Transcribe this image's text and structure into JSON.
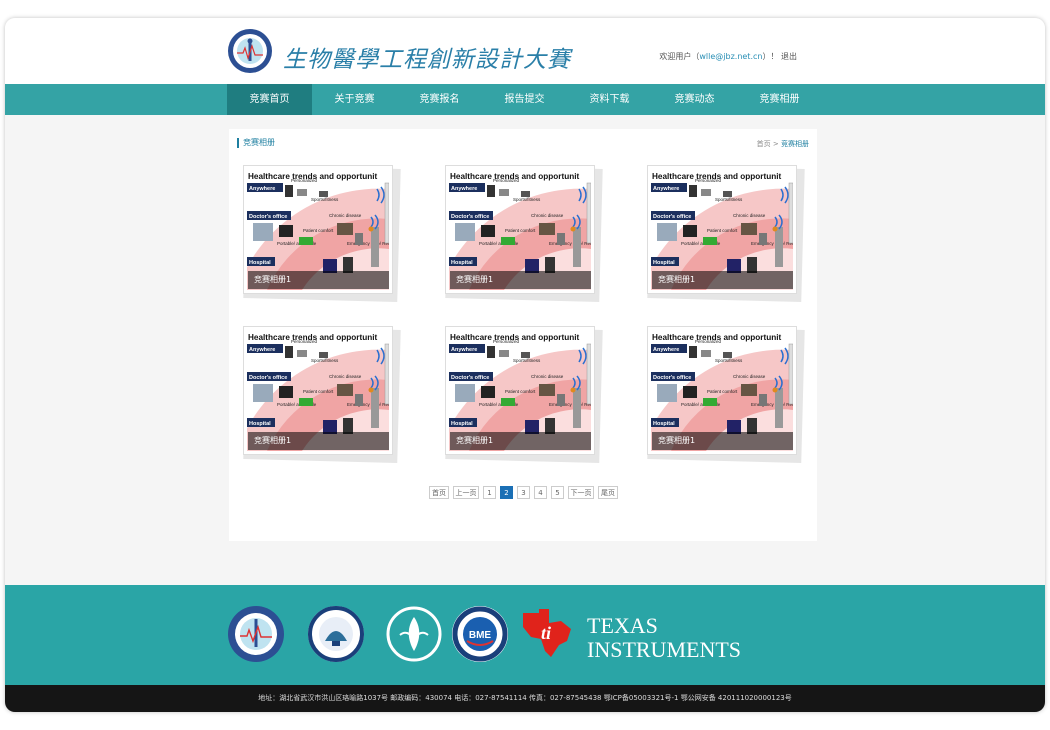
{
  "header": {
    "site_title": "生物醫學工程創新設計大賽",
    "welcome_prefix": "欢迎用户（",
    "user_email": "wlle@jbz.net.cn",
    "welcome_suffix": "）！",
    "logout": "退出"
  },
  "nav": {
    "items": [
      {
        "label": "竞赛首页"
      },
      {
        "label": "关于竞赛"
      },
      {
        "label": "竞赛报名"
      },
      {
        "label": "报告提交"
      },
      {
        "label": "资料下载"
      },
      {
        "label": "竞赛动态"
      },
      {
        "label": "竞赛相册"
      }
    ],
    "active_index": 0
  },
  "content": {
    "section_title": "竞赛相册",
    "breadcrumb": {
      "home": "首页",
      "sep": ">",
      "current": "竞赛相册"
    }
  },
  "gallery": {
    "image_heading": "Healthcare trends and opportunit",
    "image_labels": {
      "anywhere": "Anywhere",
      "doctors_office": "Doctor's office",
      "hospital": "Hospital",
      "personalized": "Personalized",
      "sports": "Sports/fitness",
      "chronic": "Chronic disease",
      "comfort": "Patient comfort",
      "portable": "Portable/ affordable",
      "emergency": "Emergency care/ Remote"
    },
    "items": [
      {
        "caption": "竞赛相册1"
      },
      {
        "caption": "竞赛相册1"
      },
      {
        "caption": "竞赛相册1"
      },
      {
        "caption": "竞赛相册1"
      },
      {
        "caption": "竞赛相册1"
      },
      {
        "caption": "竞赛相册1"
      }
    ]
  },
  "pagination": {
    "first": "首页",
    "prev": "上一页",
    "pages": [
      "1",
      "2",
      "3",
      "4",
      "5"
    ],
    "current": "2",
    "next": "下一页",
    "last": "尾页"
  },
  "footer": {
    "ti_line1": "TEXAS",
    "ti_line2": "INSTRUMENTS",
    "info": "地址：湖北省武汉市洪山区珞喻路1037号  邮政编码：430074   电话：027-87541114   传真：027-87545438   鄂ICP备05003321号-1    鄂公网安备 420111020000123号"
  },
  "colors": {
    "teal": "#34a3a5",
    "teal_dark": "#1f7d80",
    "footer_teal": "#2aa5a6",
    "page_blue": "#1a6fb5"
  },
  "icons": {
    "site_logo": "circular-seal-icon",
    "ti_logo": "texas-instruments-logo"
  }
}
